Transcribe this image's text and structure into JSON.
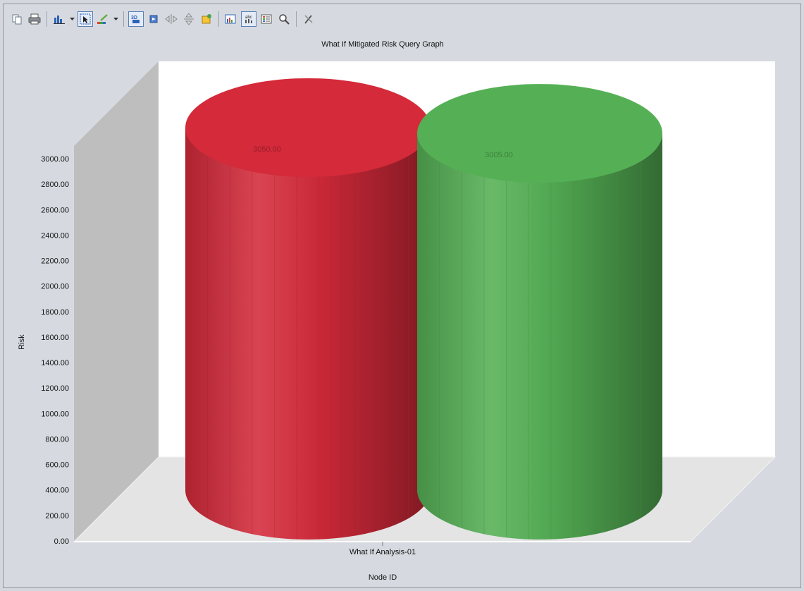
{
  "toolbar": {
    "buttons": [
      {
        "name": "copy-icon"
      },
      {
        "name": "print-icon"
      },
      {
        "name": "chart-type-icon"
      },
      {
        "name": "chart-type-dropdown-icon"
      },
      {
        "name": "select-pointer-icon"
      },
      {
        "name": "color-palette-icon"
      },
      {
        "name": "palette-dropdown-icon"
      },
      {
        "name": "view-3d-icon"
      },
      {
        "name": "rotate-icon"
      },
      {
        "name": "horizontal-rotate-icon"
      },
      {
        "name": "vertical-rotate-icon"
      },
      {
        "name": "properties-icon"
      },
      {
        "name": "data-editor-icon"
      },
      {
        "name": "point-labels-icon"
      },
      {
        "name": "legend-icon"
      },
      {
        "name": "zoom-icon"
      },
      {
        "name": "tools-icon"
      }
    ]
  },
  "chart_data": {
    "type": "bar",
    "style": "3d-cylinder",
    "title": "What If Mitigated Risk Query Graph",
    "xlabel": "Node ID",
    "ylabel": "Risk",
    "categories": [
      "What If Analysis-01"
    ],
    "series": [
      {
        "values": [
          3050.0
        ],
        "color": "#d42a3a",
        "label": "3050.00"
      },
      {
        "values": [
          3005.0
        ],
        "color": "#55b055",
        "label": "3005.00"
      }
    ],
    "ylim": [
      0,
      3000
    ],
    "yticks": [
      "0.00",
      "200.00",
      "400.00",
      "600.00",
      "800.00",
      "1000.00",
      "1200.00",
      "1400.00",
      "1600.00",
      "1800.00",
      "2000.00",
      "2200.00",
      "2400.00",
      "2600.00",
      "2800.00",
      "3000.00"
    ],
    "grid": false,
    "legend": "none"
  }
}
